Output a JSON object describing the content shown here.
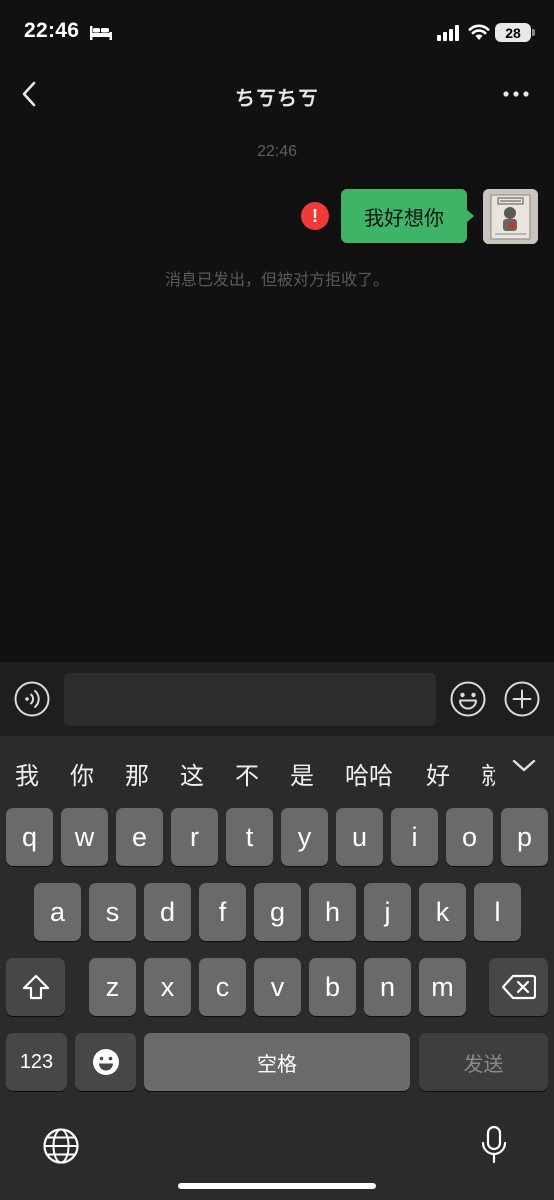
{
  "status_bar": {
    "time": "22:46",
    "battery_level": "28",
    "icons": [
      "bed-icon",
      "signal-icon",
      "wifi-icon",
      "battery-icon"
    ]
  },
  "nav": {
    "title": "ちㄎちㄎ",
    "back_icon": "chevron-left-icon",
    "more_icon": "more-dots-icon"
  },
  "conversation": {
    "timestamp": "22:46",
    "messages": [
      {
        "text": "我好想你",
        "direction": "outgoing",
        "status": "rejected",
        "status_icon": "error-icon",
        "status_symbol": "!"
      }
    ],
    "system_notice": "消息已发出，但被对方拒收了。"
  },
  "input_bar": {
    "value": "",
    "icons": [
      "voice-icon",
      "emoji-icon",
      "plus-icon"
    ]
  },
  "keyboard": {
    "candidates": [
      "我",
      "你",
      "那",
      "这",
      "不",
      "是",
      "哈哈",
      "好",
      "就"
    ],
    "row1": [
      "q",
      "w",
      "e",
      "r",
      "t",
      "y",
      "u",
      "i",
      "o",
      "p"
    ],
    "row2": [
      "a",
      "s",
      "d",
      "f",
      "g",
      "h",
      "j",
      "k",
      "l"
    ],
    "row3": [
      "z",
      "x",
      "c",
      "v",
      "b",
      "n",
      "m"
    ],
    "numbers_label": "123",
    "space_label": "空格",
    "send_label": "发送"
  },
  "colors": {
    "background": "#111111",
    "bubble_outgoing": "#3eb566",
    "error": "#f03a3a",
    "keyboard_bg": "#2b2b2b",
    "key_bg": "#6a6a6a"
  }
}
